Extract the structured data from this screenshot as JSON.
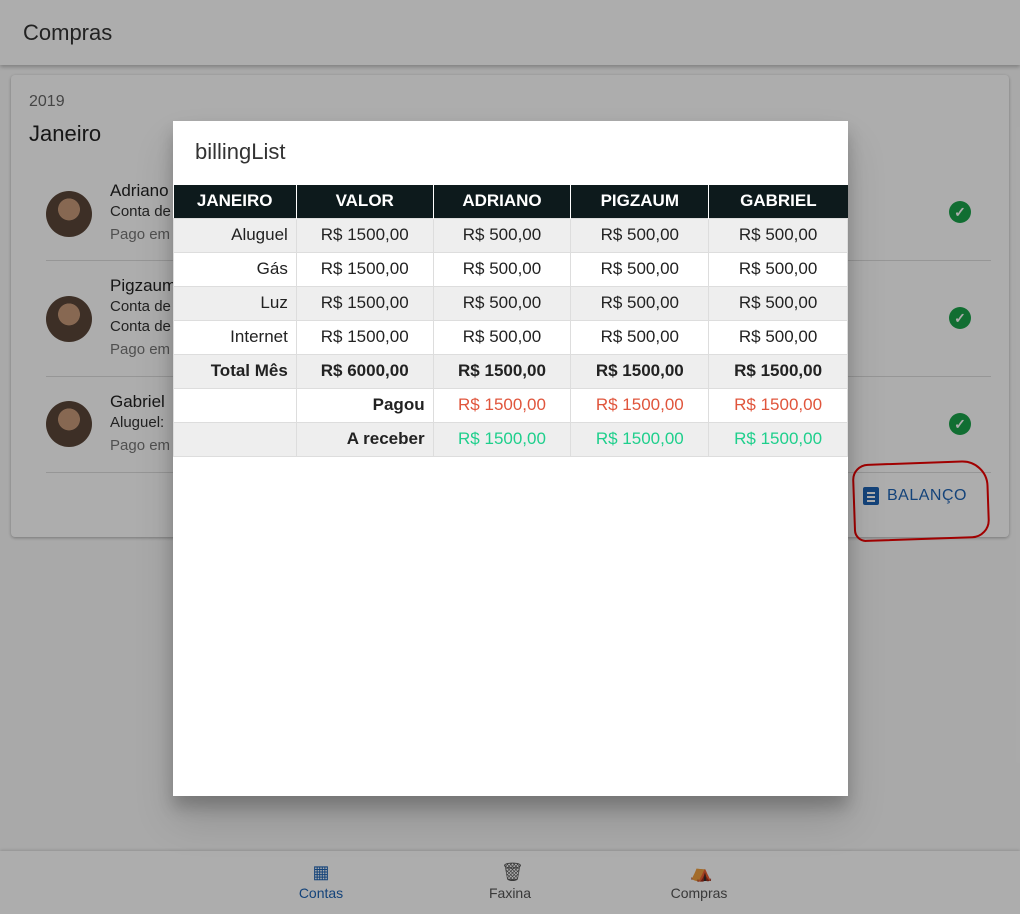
{
  "appbar": {
    "title": "Compras"
  },
  "card": {
    "year": "2019",
    "month": "Janeiro",
    "people": [
      {
        "name": "Adriano",
        "lines": [
          "Conta de",
          "Pago em"
        ]
      },
      {
        "name": "Pigzaum",
        "lines": [
          "Conta de",
          "Conta de",
          "Pago em"
        ]
      },
      {
        "name": "Gabriel",
        "lines": [
          "Aluguel:",
          "Pago em"
        ]
      }
    ],
    "balanco_label": "BALANÇO"
  },
  "dialog": {
    "title": "billingList",
    "headers": [
      "JANEIRO",
      "VALOR",
      "ADRIANO",
      "PIGZAUM",
      "GABRIEL"
    ],
    "rows": [
      {
        "label": "Aluguel",
        "cells": [
          "R$ 1500,00",
          "R$ 500,00",
          "R$ 500,00",
          "R$ 500,00"
        ]
      },
      {
        "label": "Gás",
        "cells": [
          "R$ 1500,00",
          "R$ 500,00",
          "R$ 500,00",
          "R$ 500,00"
        ]
      },
      {
        "label": "Luz",
        "cells": [
          "R$ 1500,00",
          "R$ 500,00",
          "R$ 500,00",
          "R$ 500,00"
        ]
      },
      {
        "label": "Internet",
        "cells": [
          "R$ 1500,00",
          "R$ 500,00",
          "R$ 500,00",
          "R$ 500,00"
        ]
      },
      {
        "label": "Total Mês",
        "cells": [
          "R$ 6000,00",
          "R$ 1500,00",
          "R$ 1500,00",
          "R$ 1500,00"
        ]
      }
    ],
    "paid": {
      "label": "Pagou",
      "cells": [
        "R$ 1500,00",
        "R$ 1500,00",
        "R$ 1500,00"
      ]
    },
    "receive": {
      "label": "A receber",
      "cells": [
        "R$ 1500,00",
        "R$ 1500,00",
        "R$ 1500,00"
      ]
    }
  },
  "bottomnav": {
    "items": [
      {
        "label": "Contas",
        "icon": "calculator-icon",
        "active": true
      },
      {
        "label": "Faxina",
        "icon": "trash-icon",
        "active": false
      },
      {
        "label": "Compras",
        "icon": "basket-icon",
        "active": false
      }
    ]
  },
  "colors": {
    "accent": "#1e64b4",
    "paid": "#e0553c",
    "receive": "#1ecf8c",
    "check": "#1aa34a",
    "header": "#0d1a1c"
  }
}
